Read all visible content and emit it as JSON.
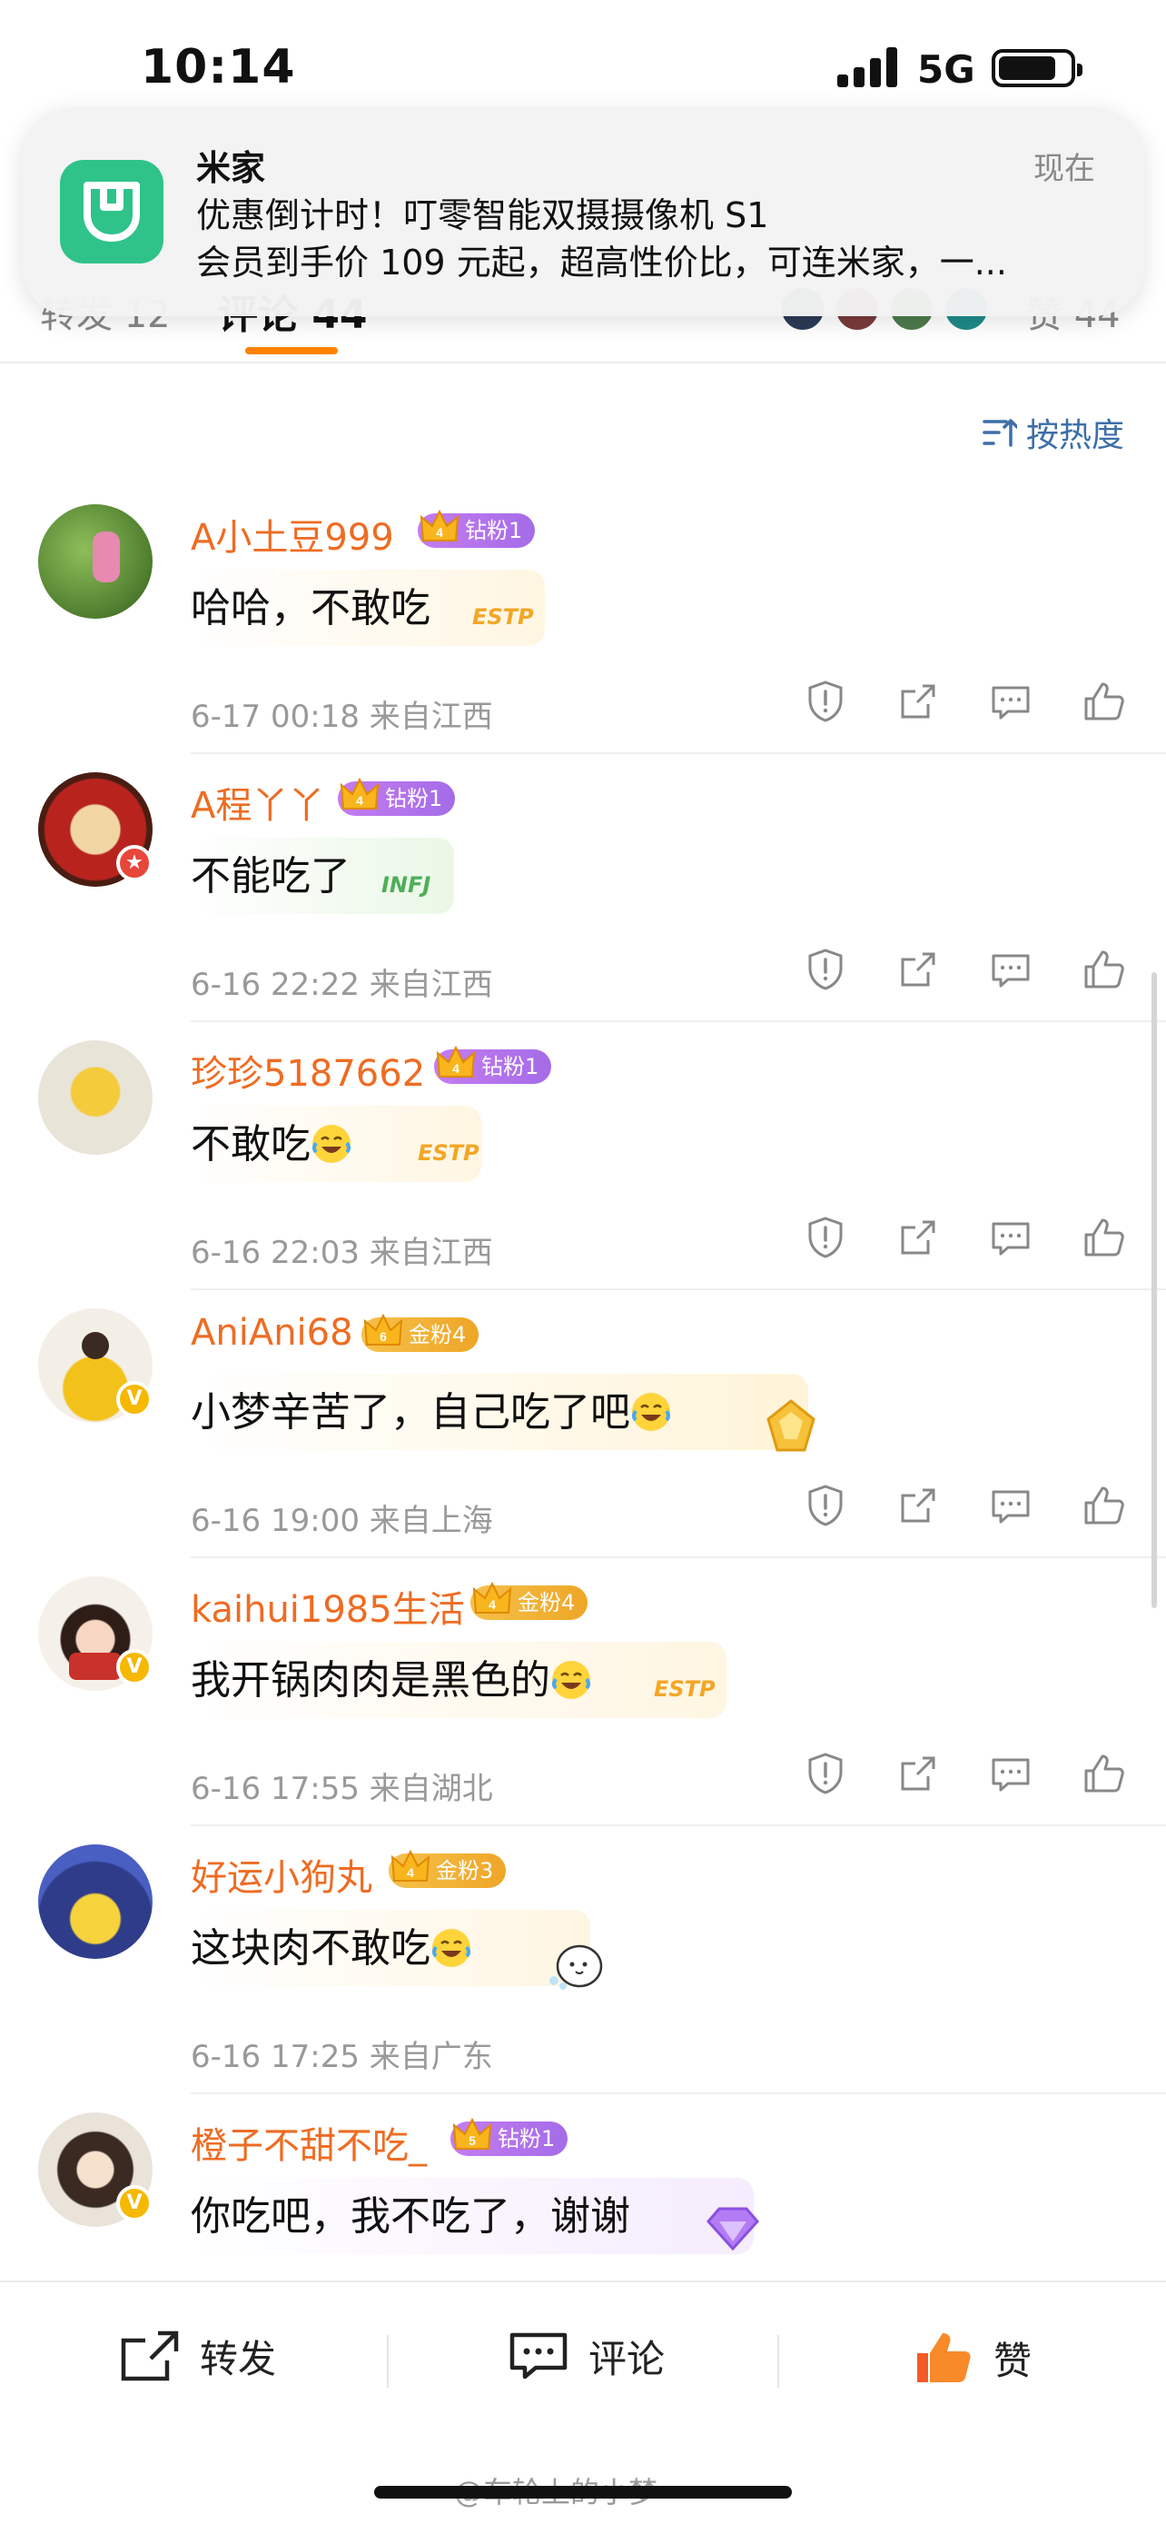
{
  "status_bar": {
    "time": "10:14",
    "network": "5G"
  },
  "notification": {
    "app": "米家",
    "time": "现在",
    "title": "优惠倒计时！叮零智能双摄摄像机 S1",
    "body": "会员到手价 109 元起，超高性价比，可连米家，一..."
  },
  "tabs": {
    "repost": "转发 12",
    "comments": "评论 44",
    "likes": "赞 44"
  },
  "sort": {
    "label": "按热度"
  },
  "comments": [
    {
      "username": "A小土豆999",
      "badge": "钻粉1",
      "badge_type": "diamond",
      "badge_level": "4",
      "text": "哈哈，不敢吃",
      "sticker": "ESTP",
      "date": "6-17 00:18",
      "location": "来自江西",
      "verified": ""
    },
    {
      "username": "A程丫丫",
      "badge": "钻粉1",
      "badge_type": "diamond",
      "badge_level": "4",
      "text": "不能吃了",
      "sticker": "INFJ",
      "date": "6-16 22:22",
      "location": "来自江西",
      "verified": "red"
    },
    {
      "username": "珍珍5187662",
      "badge": "钻粉1",
      "badge_type": "diamond",
      "badge_level": "4",
      "text": "不敢吃",
      "sticker": "ESTP",
      "date": "6-16 22:03",
      "location": "来自江西",
      "verified": ""
    },
    {
      "username": "AniAni68",
      "badge": "金粉4",
      "badge_type": "gold",
      "badge_level": "6",
      "text": "小梦辛苦了，自己吃了吧",
      "sticker": "",
      "date": "6-16 19:00",
      "location": "来自上海",
      "verified": "v"
    },
    {
      "username": "kaihui1985生活",
      "badge": "金粉4",
      "badge_type": "gold",
      "badge_level": "4",
      "text": "我开锅肉肉是黑色的",
      "sticker": "ESTP",
      "date": "6-16 17:55",
      "location": "来自湖北",
      "verified": "v"
    },
    {
      "username": "好运小狗丸",
      "badge": "金粉3",
      "badge_type": "gold",
      "badge_level": "4",
      "text": "这块肉不敢吃",
      "sticker": "",
      "date": "6-16 17:25",
      "location": "来自广东",
      "verified": ""
    },
    {
      "username": "橙子不甜不吃_",
      "badge": "钻粉1",
      "badge_type": "diamond",
      "badge_level": "5",
      "text": "你吃吧，我不吃了，谢谢",
      "sticker": "",
      "date": "",
      "location": "",
      "verified": "v"
    }
  ],
  "bottom_bar": {
    "repost": "转发",
    "comment": "评论",
    "like": "赞"
  },
  "watermark": "@车轮上的小梦",
  "colors": {
    "accent": "#ff8200",
    "username": "#ee6c23",
    "link": "#3d6fa8"
  }
}
